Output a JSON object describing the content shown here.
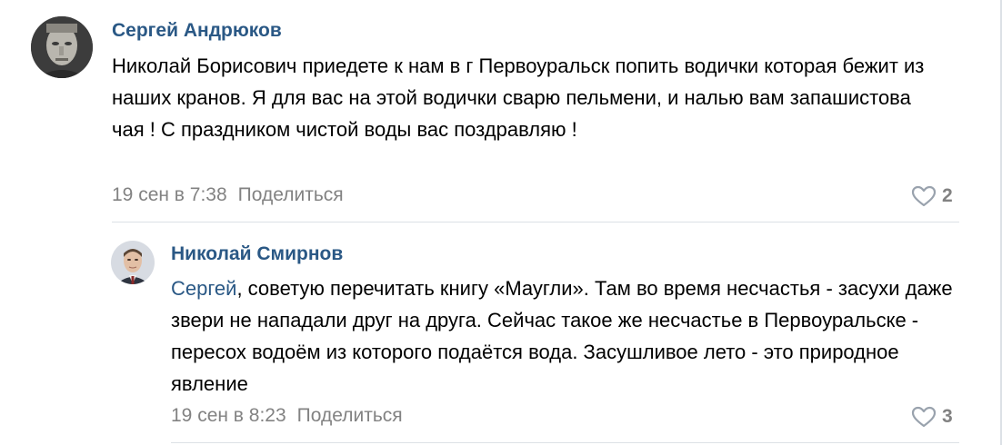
{
  "comments": [
    {
      "author": "Сергей Андрюков",
      "text": "Николай Борисович приедете к нам в г Первоуральск попить водички которая бежит из наших кранов. Я для вас на этой водички сварю пельмени, и налью вам запашистова чая ! С праздником чистой воды вас поздравляю !",
      "date": "19 сен в 7:38",
      "share_label": "Поделиться",
      "likes": "2"
    },
    {
      "author": "Николай Смирнов",
      "mention": "Сергей",
      "text": ", советую перечитать книгу «Маугли». Там во время несчастья - засухи даже звери не нападали друг на друга. Сейчас такое же несчастье в Первоуральске - пересох водоём из которого подаётся вода. Засушливое лето - это природное явление",
      "date": "19 сен в 8:23",
      "share_label": "Поделиться",
      "likes": "3"
    }
  ],
  "icons": {
    "like": "heart-icon"
  },
  "colors": {
    "link": "#2a5885",
    "meta": "#828282",
    "divider": "#dce1e6"
  }
}
